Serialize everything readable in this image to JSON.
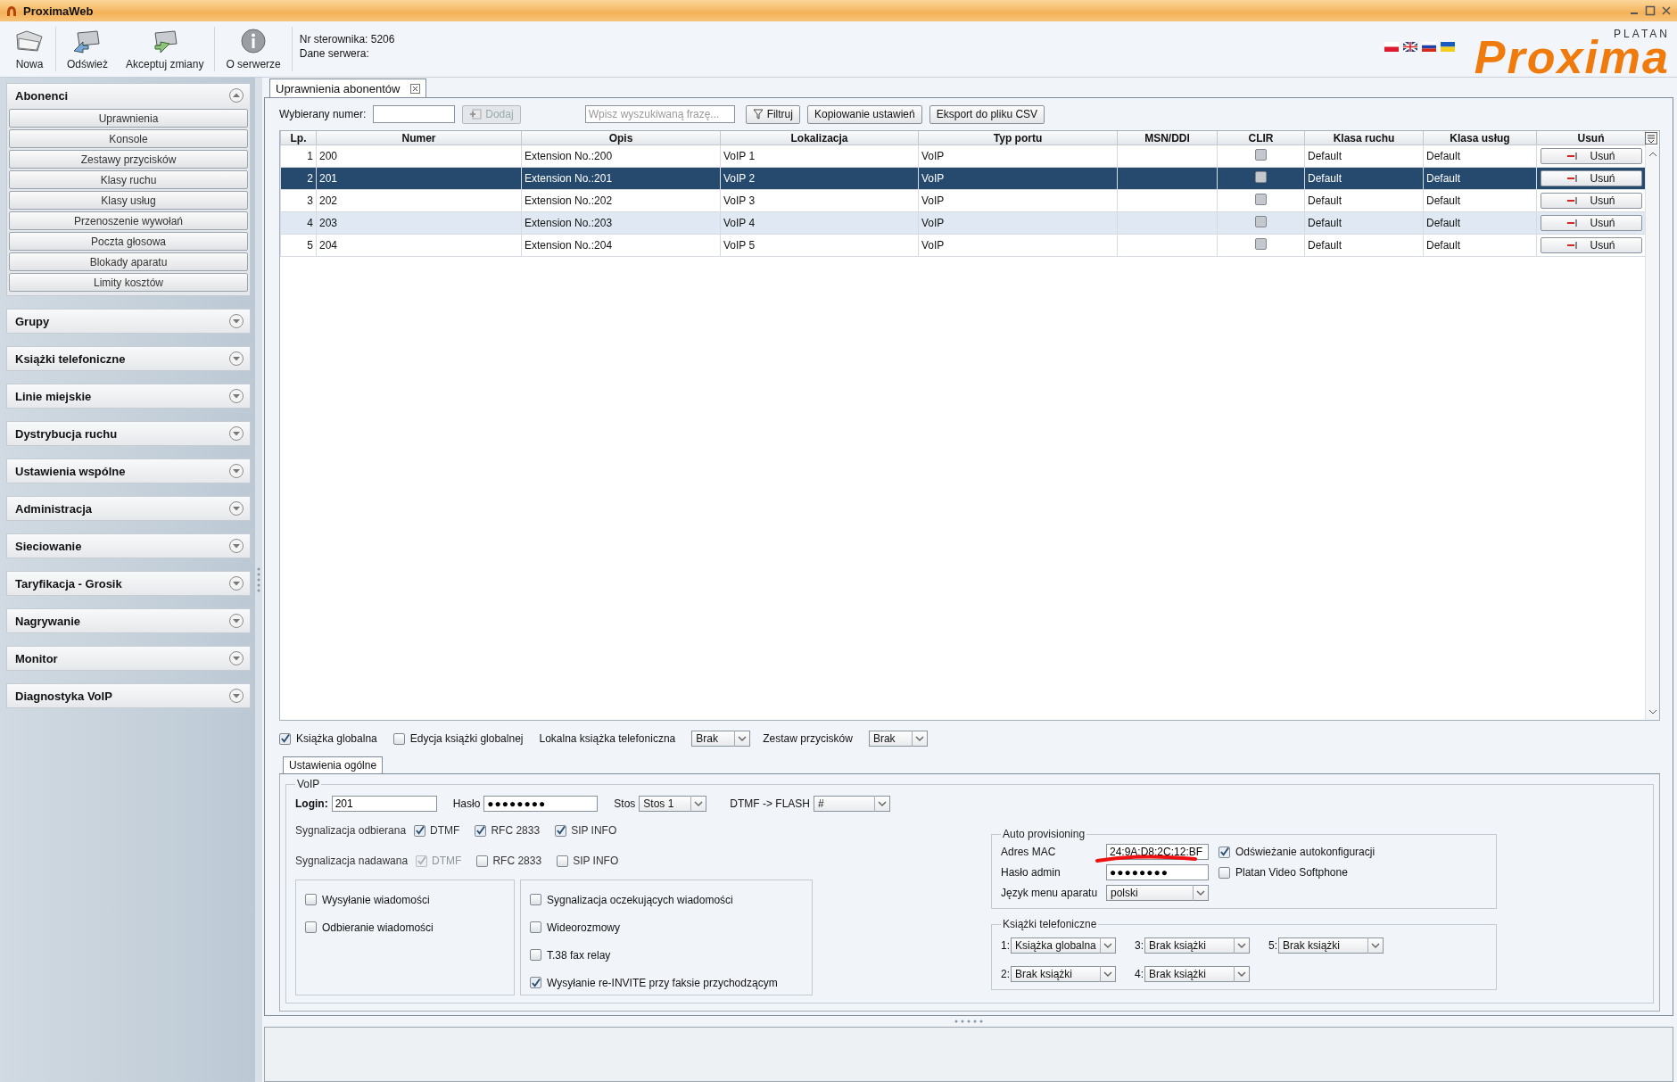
{
  "window": {
    "title": "ProximaWeb"
  },
  "toolbar": {
    "buttons": [
      {
        "label": "Nowa",
        "kind": "new"
      },
      {
        "label": "Odśwież",
        "kind": "refresh"
      },
      {
        "label": "Akceptuj zmiany",
        "kind": "accept"
      },
      {
        "label": "O serwerze",
        "kind": "info"
      }
    ],
    "server_info": [
      "Nr sterownika: 5206",
      "Dane serwera:"
    ]
  },
  "logo": {
    "brand": "Proxima",
    "maker": "PLATAN"
  },
  "languages": [
    {
      "kind": "pl"
    },
    {
      "kind": "en"
    },
    {
      "kind": "ru"
    },
    {
      "kind": "ua"
    }
  ],
  "sidebar": {
    "sections": [
      {
        "title": "Abonenci",
        "expanded": true,
        "items": [
          "Uprawnienia",
          "Konsole",
          "Zestawy przycisków",
          "Klasy ruchu",
          "Klasy usług",
          "Przenoszenie wywołań",
          "Poczta głosowa",
          "Blokady aparatu",
          "Limity kosztów"
        ]
      },
      {
        "title": "Grupy",
        "expanded": false
      },
      {
        "title": "Książki telefoniczne",
        "expanded": false
      },
      {
        "title": "Linie miejskie",
        "expanded": false
      },
      {
        "title": "Dystrybucja ruchu",
        "expanded": false
      },
      {
        "title": "Ustawienia wspólne",
        "expanded": false
      },
      {
        "title": "Administracja",
        "expanded": false
      },
      {
        "title": "Sieciowanie",
        "expanded": false
      },
      {
        "title": "Taryfikacja - Grosik",
        "expanded": false
      },
      {
        "title": "Nagrywanie",
        "expanded": false
      },
      {
        "title": "Monitor",
        "expanded": false
      },
      {
        "title": "Diagnostyka VoIP",
        "expanded": false
      }
    ]
  },
  "tab": {
    "label": "Uprawnienia abonentów"
  },
  "filter": {
    "label": "Wybierany numer:",
    "add_button": "Dodaj",
    "add_disabled": true,
    "search_placeholder": "Wpisz wyszukiwaną frazę...",
    "buttons": [
      {
        "label": "Filtruj",
        "kind": "filter"
      },
      {
        "label": "Kopiowanie ustawień",
        "kind": "plain"
      },
      {
        "label": "Eksport do pliku CSV",
        "kind": "plain"
      }
    ]
  },
  "table": {
    "columns": [
      "Lp.",
      "Numer",
      "Opis",
      "Lokalizacja",
      "Typ portu",
      "MSN/DDI",
      "CLIR",
      "Klasa ruchu",
      "Klasa usług",
      "Usuń"
    ],
    "rows": [
      {
        "lp": "1",
        "numer": "200",
        "opis": "Extension No.:200",
        "lokalizacja": "VoIP 1",
        "typ": "VoIP",
        "clir": false,
        "klasa_ruchu": "Default",
        "klasa_uslug": "Default",
        "delete": "Usuń",
        "selected": false,
        "highlighted": false
      },
      {
        "lp": "2",
        "numer": "201",
        "opis": "Extension No.:201",
        "lokalizacja": "VoIP 2",
        "typ": "VoIP",
        "clir": false,
        "klasa_ruchu": "Default",
        "klasa_uslug": "Default",
        "delete": "Usuń",
        "selected": true,
        "highlighted": false
      },
      {
        "lp": "3",
        "numer": "202",
        "opis": "Extension No.:202",
        "lokalizacja": "VoIP 3",
        "typ": "VoIP",
        "clir": false,
        "klasa_ruchu": "Default",
        "klasa_uslug": "Default",
        "delete": "Usuń",
        "selected": false,
        "highlighted": false
      },
      {
        "lp": "4",
        "numer": "203",
        "opis": "Extension No.:203",
        "lokalizacja": "VoIP 4",
        "typ": "VoIP",
        "clir": false,
        "klasa_ruchu": "Default",
        "klasa_uslug": "Default",
        "delete": "Usuń",
        "selected": false,
        "highlighted": true
      },
      {
        "lp": "5",
        "numer": "204",
        "opis": "Extension No.:204",
        "lokalizacja": "VoIP 5",
        "typ": "VoIP",
        "clir": false,
        "klasa_ruchu": "Default",
        "klasa_uslug": "Default",
        "delete": "Usuń",
        "selected": false,
        "highlighted": false
      }
    ]
  },
  "options": {
    "checkboxes": [
      {
        "label": "Książka globalna",
        "checked": true
      },
      {
        "label": "Edycja książki globalnej",
        "checked": false
      }
    ],
    "selects": [
      {
        "label": "Lokalna książka telefoniczna",
        "value": "Brak"
      },
      {
        "label": "Zestaw przycisków",
        "value": "Brak"
      }
    ]
  },
  "settings": {
    "tab": "Ustawienia ogólne",
    "voip": {
      "legend": "VoIP",
      "login": {
        "label": "Login:",
        "value": "201"
      },
      "password": {
        "label": "Hasło",
        "value": "●●●●●●●●"
      },
      "stack": {
        "label": "Stos",
        "value": "Stos 1"
      },
      "flash": {
        "label": "DTMF -> FLASH",
        "value": "#"
      },
      "rx": {
        "label": "Sygnalizacja odbierana",
        "options": [
          {
            "label": "DTMF",
            "checked": true,
            "disabled": false
          },
          {
            "label": "RFC 2833",
            "checked": true,
            "disabled": false
          },
          {
            "label": "SIP INFO",
            "checked": true,
            "disabled": false
          }
        ]
      },
      "tx": {
        "label": "Sygnalizacja nadawana",
        "options": [
          {
            "label": "DTMF",
            "checked": true,
            "disabled": true
          },
          {
            "label": "RFC 2833",
            "checked": false,
            "disabled": false
          },
          {
            "label": "SIP INFO",
            "checked": false,
            "disabled": false
          }
        ]
      },
      "box_left": [
        {
          "label": "Wysyłanie wiadomości",
          "checked": false
        },
        {
          "label": "Odbieranie wiadomości",
          "checked": false
        }
      ],
      "box_right": [
        {
          "label": "Sygnalizacja oczekujących wiadomości",
          "checked": false
        },
        {
          "label": "Wideorozmowy",
          "checked": false
        },
        {
          "label": "T.38 fax relay",
          "checked": false
        },
        {
          "label": "Wysyłanie re-INVITE przy faksie przychodzącym",
          "checked": true
        }
      ]
    },
    "auto_provisioning": {
      "legend": "Auto provisioning",
      "mac": {
        "label": "Adres MAC",
        "value": "24:9A:D8:2C:12:BF"
      },
      "admin_password": {
        "label": "Hasło admin",
        "value": "●●●●●●●●"
      },
      "language": {
        "label": "Język menu aparatu",
        "value": "polski"
      },
      "checkboxes": [
        {
          "label": "Odświeżanie autokonfiguracji",
          "checked": true
        },
        {
          "label": "Platan Video Softphone",
          "checked": false
        }
      ]
    },
    "phonebooks": {
      "legend": "Książki telefoniczne",
      "slots": [
        {
          "label": "1:",
          "value": "Książka globalna"
        },
        {
          "label": "3:",
          "value": "Brak książki"
        },
        {
          "label": "5:",
          "value": "Brak książki"
        },
        {
          "label": "2:",
          "value": "Brak książki"
        },
        {
          "label": "4:",
          "value": "Brak książki"
        }
      ]
    }
  }
}
